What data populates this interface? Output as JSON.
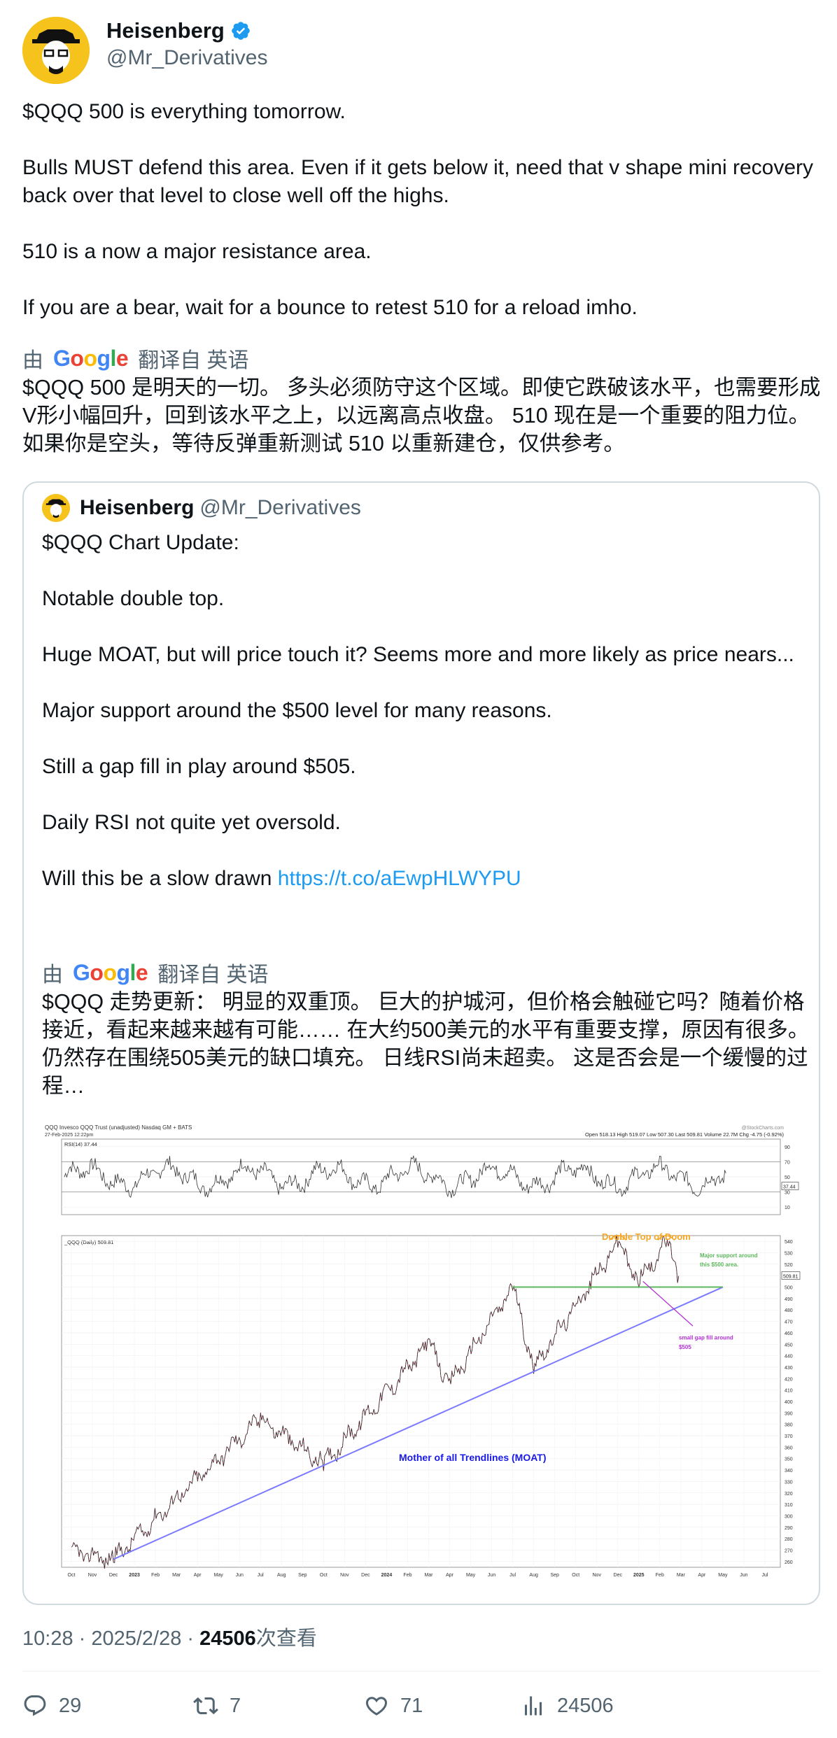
{
  "author": {
    "name": "Heisenberg",
    "handle": "@Mr_Derivatives"
  },
  "tweet": {
    "paragraphs": [
      "$QQQ 500 is everything tomorrow.",
      "Bulls MUST defend this area. Even if it gets below it, need that v shape mini recovery back over that level to close well off the highs.",
      "510 is a now a major resistance area.",
      "If you are a bear, wait for a bounce to retest 510 for a reload imho."
    ],
    "translated_prefix": "由",
    "translated_brand": "Google",
    "translated_suffix": "翻译自 英语",
    "translation": "$QQQ 500 是明天的一切。 多头必须防守这个区域。即使它跌破该水平，也需要形成V形小幅回升，回到该水平之上，以远离高点收盘。 510 现在是一个重要的阻力位。 如果你是空头，等待反弹重新测试 510 以重新建仓，仅供参考。"
  },
  "quote": {
    "name": "Heisenberg",
    "handle": "@Mr_Derivatives",
    "paragraphs": [
      "$QQQ Chart Update:",
      "Notable double top.",
      "Huge MOAT, but will price touch it? Seems more and more likely as price nears...",
      "Major support around the $500 level for many reasons.",
      "Still a gap fill in play around $505.",
      "Daily RSI not quite yet oversold."
    ],
    "last_line_text": "Will this be a slow drawn ",
    "link": "https://t.co/aEwpHLWYPU",
    "translated_prefix": "由",
    "translated_brand": "Google",
    "translated_suffix": "翻译自 英语",
    "translation": "$QQQ 走势更新： 明显的双重顶。 巨大的护城河，但价格会触碰它吗？随着价格接近，看起来越来越有可能…… 在大约500美元的水平有重要支撑，原因有很多。 仍然存在围绕505美元的缺口填充。 日线RSI尚未超卖。 这是否会是一个缓慢的过程…"
  },
  "chart_data": {
    "type": "line",
    "header": "QQQ Invesco QQQ Trust (unadjusted) Nasdaq GM + BATS",
    "date_stamp": "27-Feb-2025 12:22pm",
    "watermark": "@StockCharts.com",
    "quote_line": "Open 518.13  High 519.07  Low 507.30  Last 509.81  Volume 22.7M  Chg -4.75 (-0.92%)",
    "rsi_label": "RSI(14) 37.44",
    "rsi_ticks": [
      "90",
      "70",
      "50",
      "30",
      "10"
    ],
    "rsi_last": "37.44",
    "price_label": "_QQQ (Daily) 509.81",
    "price_last": "509.81",
    "y_ticks": [
      "540",
      "530",
      "520",
      "510",
      "500",
      "490",
      "480",
      "470",
      "460",
      "450",
      "440",
      "430",
      "420",
      "410",
      "400",
      "390",
      "380",
      "370",
      "360",
      "350",
      "340",
      "330",
      "320",
      "310",
      "300",
      "290",
      "280",
      "270",
      "260"
    ],
    "x_ticks": [
      "Oct",
      "Nov",
      "Dec",
      "2023",
      "Feb",
      "Mar",
      "Apr",
      "May",
      "Jun",
      "Jul",
      "Aug",
      "Sep",
      "Oct",
      "Nov",
      "Dec",
      "2024",
      "Feb",
      "Mar",
      "Apr",
      "May",
      "Jun",
      "Jul",
      "Aug",
      "Sep",
      "Oct",
      "Nov",
      "Dec",
      "2025",
      "Feb",
      "Mar",
      "Apr",
      "May",
      "Jun",
      "Jul"
    ],
    "annotations": {
      "double_top": "Double Top of Doom",
      "support": "Major support around this $500 area.",
      "gap": "small gap fill around $505",
      "moat": "Mother of all Trendlines (MOAT)"
    },
    "key_points": [
      {
        "x": "Oct 2022",
        "y": 268
      },
      {
        "x": "Dec 2022",
        "y": 262
      },
      {
        "x": "Jul 2023",
        "y": 385
      },
      {
        "x": "Oct 2023",
        "y": 345
      },
      {
        "x": "Mar 2024",
        "y": 450
      },
      {
        "x": "Apr 2024",
        "y": 415
      },
      {
        "x": "Jul 2024",
        "y": 500
      },
      {
        "x": "Aug 2024",
        "y": 430
      },
      {
        "x": "Dec 2024",
        "y": 538
      },
      {
        "x": "Jan 2025",
        "y": 505
      },
      {
        "x": "Feb 2025",
        "y": 538
      },
      {
        "x": "27 Feb 2025",
        "y": 509.81
      }
    ],
    "support_level": 500,
    "gap_level": 505,
    "ylim": [
      255,
      545
    ]
  },
  "footer": {
    "time": "10:28",
    "date": "2025/2/28",
    "views": "24506",
    "views_suffix": "次查看",
    "replies": "29",
    "retweets": "7",
    "likes": "71",
    "view_count": "24506"
  },
  "colors": {
    "link": "#1d9bf0",
    "secondary": "#536471",
    "verified": "#1d9bf0",
    "moat_line": "#7b7bff",
    "annotation_orange": "#f5a623",
    "annotation_green": "#5cb85c",
    "annotation_purple": "#b22fd4",
    "moat_text": "#1a1ae6"
  }
}
